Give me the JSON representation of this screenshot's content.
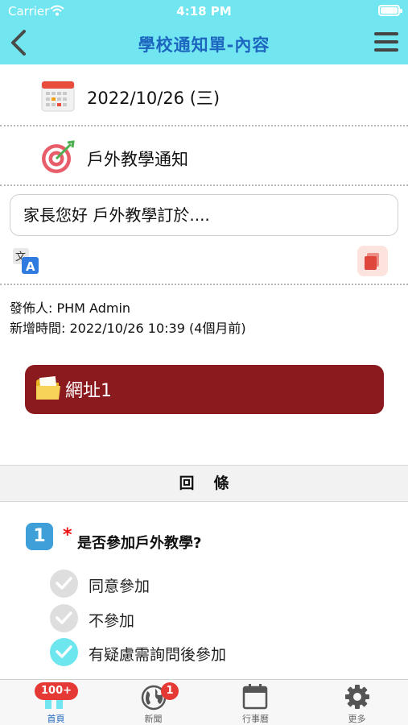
{
  "status_bar": {
    "carrier": "Carrier",
    "time": "4:18 PM"
  },
  "nav": {
    "title": "學校通知單-內容"
  },
  "notice": {
    "date": "2022/10/26 (三)",
    "subject": "戶外教學通知",
    "message": "家長您好 戶外教學訂於...."
  },
  "meta": {
    "publisher": "發佈人: PHM Admin",
    "created": "新增時間: 2022/10/26 10:39 (4個月前)"
  },
  "link_button": {
    "label": "網址1"
  },
  "reply": {
    "header": "回條",
    "question": {
      "number": "1",
      "required_mark": "*",
      "text": "是否參加戶外教學?"
    },
    "options": [
      {
        "label": "同意參加",
        "selected": false
      },
      {
        "label": "不參加",
        "selected": false
      },
      {
        "label": "有疑慮需詢問後參加",
        "selected": true
      }
    ]
  },
  "tabbar": {
    "tabs": [
      {
        "label": "首頁",
        "icon": "home-icon",
        "badge": "100+",
        "active": true
      },
      {
        "label": "新聞",
        "icon": "globe-icon",
        "badge": "1",
        "active": false
      },
      {
        "label": "行事曆",
        "icon": "calendar-icon",
        "badge": "",
        "active": false
      },
      {
        "label": "更多",
        "icon": "gear-icon",
        "badge": "",
        "active": false
      }
    ]
  },
  "colors": {
    "nav_bg": "#72e6f0",
    "title": "#1d66c0",
    "link_button_bg": "#8b1a1e",
    "check_selected": "#6ee6ee",
    "badge": "#e53935"
  }
}
